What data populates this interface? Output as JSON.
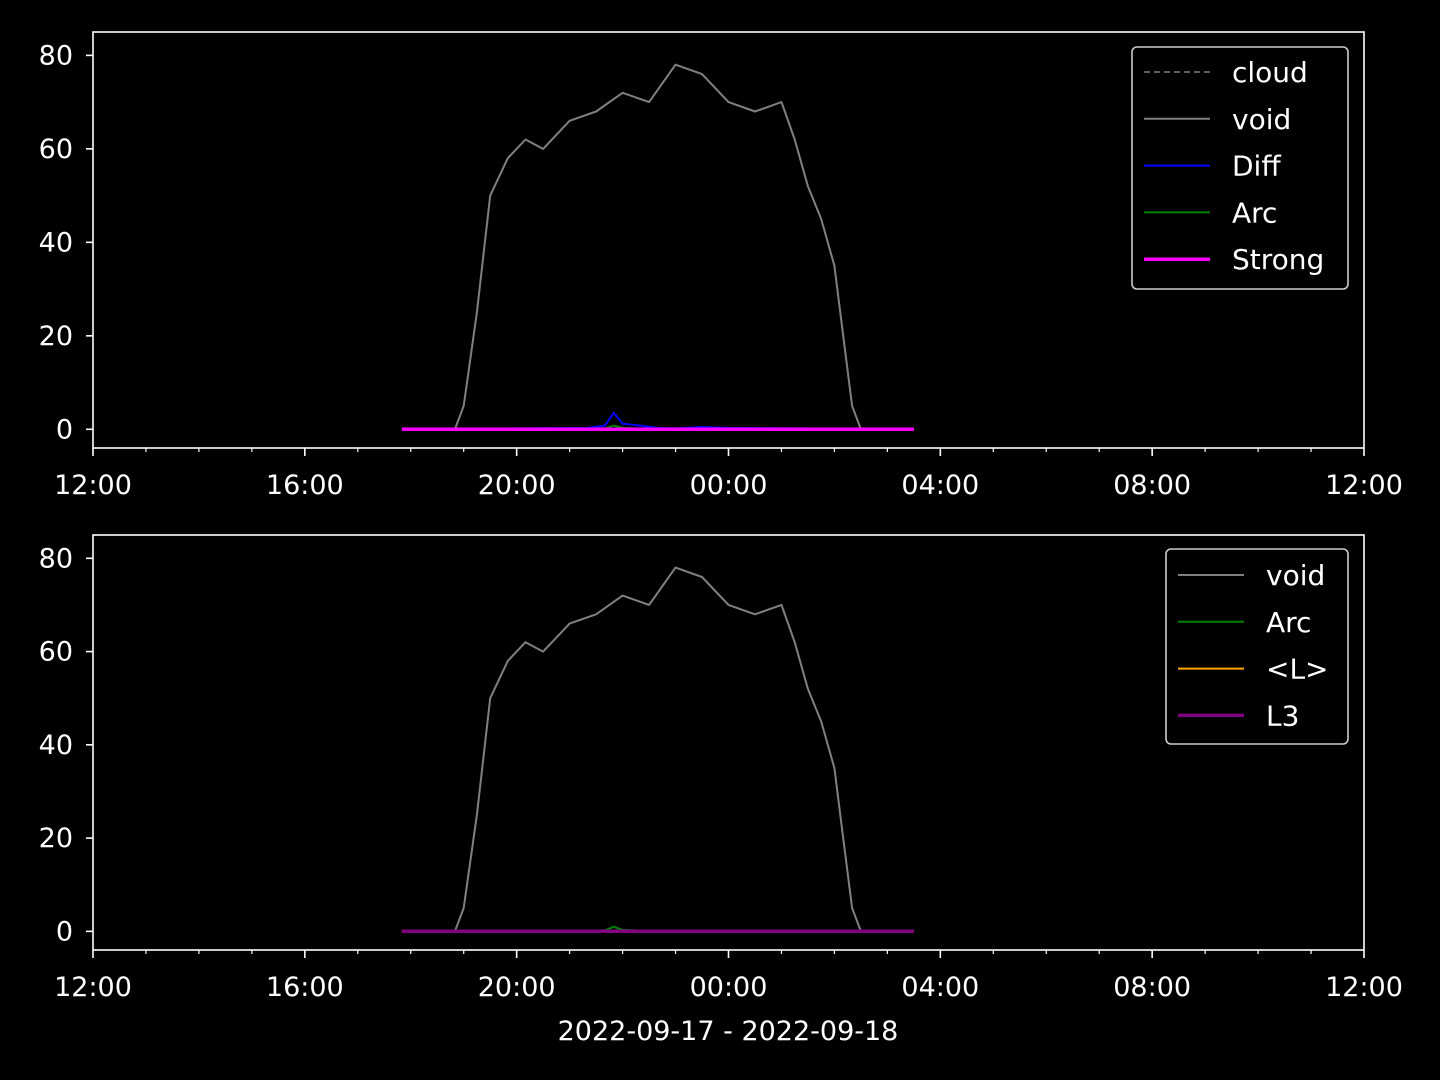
{
  "chart_data": [
    {
      "type": "line",
      "x_axis": {
        "ticks": [
          "12:00",
          "16:00",
          "20:00",
          "00:00",
          "04:00",
          "08:00",
          "12:00"
        ],
        "range": [
          "2022-09-17 12:00",
          "2022-09-18 12:00"
        ]
      },
      "y_axis": {
        "ticks": [
          0,
          20,
          40,
          60,
          80
        ],
        "ylim": [
          -4,
          85
        ]
      },
      "legend": "top-right",
      "series": [
        {
          "name": "cloud",
          "color": "#808080",
          "style": "dashed",
          "values": []
        },
        {
          "name": "void",
          "color": "#808080",
          "style": "solid",
          "x": [
            "2022-09-17 17:50",
            "2022-09-17 18:50",
            "2022-09-17 19:00",
            "2022-09-17 19:15",
            "2022-09-17 19:30",
            "2022-09-17 19:50",
            "2022-09-17 20:10",
            "2022-09-17 20:30",
            "2022-09-17 21:00",
            "2022-09-17 21:30",
            "2022-09-17 22:00",
            "2022-09-17 22:30",
            "2022-09-17 23:00",
            "2022-09-17 23:30",
            "2022-09-18 00:00",
            "2022-09-18 00:30",
            "2022-09-18 01:00",
            "2022-09-18 01:15",
            "2022-09-18 01:30",
            "2022-09-18 01:45",
            "2022-09-18 02:00",
            "2022-09-18 02:10",
            "2022-09-18 02:20",
            "2022-09-18 02:30",
            "2022-09-18 03:00",
            "2022-09-18 03:30"
          ],
          "values": [
            0,
            0,
            5,
            25,
            50,
            58,
            62,
            60,
            66,
            68,
            72,
            70,
            78,
            76,
            70,
            68,
            70,
            62,
            52,
            45,
            35,
            20,
            5,
            0,
            0,
            0
          ]
        },
        {
          "name": "Diff",
          "color": "#0000ff",
          "style": "solid",
          "x": [
            "2022-09-17 17:50",
            "2022-09-17 21:20",
            "2022-09-17 21:40",
            "2022-09-17 21:50",
            "2022-09-17 22:00",
            "2022-09-17 22:20",
            "2022-09-17 22:40",
            "2022-09-17 23:00",
            "2022-09-17 23:30",
            "2022-09-18 00:00",
            "2022-09-18 03:30"
          ],
          "values": [
            0,
            0.3,
            0.8,
            3.5,
            1.2,
            0.8,
            0.3,
            0.2,
            0.5,
            0.3,
            0
          ]
        },
        {
          "name": "Arc",
          "color": "#008000",
          "style": "solid",
          "x": [
            "2022-09-17 17:50",
            "2022-09-17 21:40",
            "2022-09-17 21:50",
            "2022-09-17 22:00",
            "2022-09-17 22:30",
            "2022-09-18 03:30"
          ],
          "values": [
            0,
            0.2,
            0.8,
            0.3,
            0.1,
            0
          ]
        },
        {
          "name": "Strong",
          "color": "#ff00ff",
          "style": "solid",
          "x": [
            "2022-09-17 17:50",
            "2022-09-18 03:30"
          ],
          "values": [
            0,
            0
          ]
        }
      ]
    },
    {
      "type": "line",
      "x_axis": {
        "ticks": [
          "12:00",
          "16:00",
          "20:00",
          "00:00",
          "04:00",
          "08:00",
          "12:00"
        ],
        "range": [
          "2022-09-17 12:00",
          "2022-09-18 12:00"
        ]
      },
      "y_axis": {
        "ticks": [
          0,
          20,
          40,
          60,
          80
        ],
        "ylim": [
          -4,
          85
        ]
      },
      "legend": "top-right",
      "xlabel": "2022-09-17 - 2022-09-18",
      "series": [
        {
          "name": "void",
          "color": "#808080",
          "style": "solid",
          "x": [
            "2022-09-17 17:50",
            "2022-09-17 18:50",
            "2022-09-17 19:00",
            "2022-09-17 19:15",
            "2022-09-17 19:30",
            "2022-09-17 19:50",
            "2022-09-17 20:10",
            "2022-09-17 20:30",
            "2022-09-17 21:00",
            "2022-09-17 21:30",
            "2022-09-17 22:00",
            "2022-09-17 22:30",
            "2022-09-17 23:00",
            "2022-09-17 23:30",
            "2022-09-18 00:00",
            "2022-09-18 00:30",
            "2022-09-18 01:00",
            "2022-09-18 01:15",
            "2022-09-18 01:30",
            "2022-09-18 01:45",
            "2022-09-18 02:00",
            "2022-09-18 02:10",
            "2022-09-18 02:20",
            "2022-09-18 02:30",
            "2022-09-18 03:00",
            "2022-09-18 03:30"
          ],
          "values": [
            0,
            0,
            5,
            25,
            50,
            58,
            62,
            60,
            66,
            68,
            72,
            70,
            78,
            76,
            70,
            68,
            70,
            62,
            52,
            45,
            35,
            20,
            5,
            0,
            0,
            0
          ]
        },
        {
          "name": "Arc",
          "color": "#008000",
          "style": "solid",
          "x": [
            "2022-09-17 17:50",
            "2022-09-17 21:40",
            "2022-09-17 21:50",
            "2022-09-17 22:00",
            "2022-09-17 22:30",
            "2022-09-18 03:30"
          ],
          "values": [
            0,
            0.2,
            1.0,
            0.3,
            0.1,
            0
          ]
        },
        {
          "name": "<L>",
          "color": "#ffa500",
          "style": "solid",
          "x": [
            "2022-09-17 17:50",
            "2022-09-18 03:30"
          ],
          "values": [
            0,
            0
          ]
        },
        {
          "name": "L3",
          "color": "#800080",
          "style": "solid",
          "x": [
            "2022-09-17 17:50",
            "2022-09-18 03:30"
          ],
          "values": [
            0,
            0
          ]
        }
      ]
    }
  ]
}
